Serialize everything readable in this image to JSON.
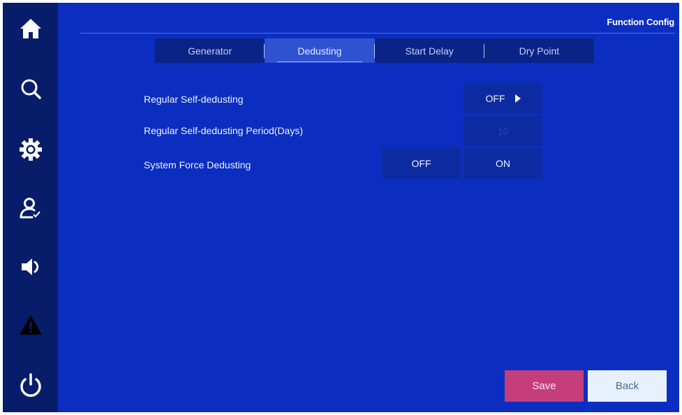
{
  "header": {
    "title": "Function Config"
  },
  "sidebar": {
    "items": [
      {
        "icon": "home-icon"
      },
      {
        "icon": "search-icon"
      },
      {
        "icon": "gear-icon"
      },
      {
        "icon": "user-check-icon"
      },
      {
        "icon": "speaker-icon"
      },
      {
        "icon": "warning-icon"
      },
      {
        "icon": "power-icon"
      }
    ]
  },
  "tabs": [
    {
      "label": "Generator",
      "active": false
    },
    {
      "label": "Dedusting",
      "active": true
    },
    {
      "label": "Start Delay",
      "active": false
    },
    {
      "label": "Dry Point",
      "active": false
    }
  ],
  "settings": {
    "regular_self_dedusting": {
      "label": "Regular Self-dedusting",
      "value": "OFF"
    },
    "regular_self_dedusting_period": {
      "label": "Regular Self-dedusting Period(Days)",
      "value": "10"
    },
    "system_force_dedusting": {
      "label": "System Force Dedusting",
      "off_label": "OFF",
      "on_label": "ON"
    }
  },
  "footer": {
    "save_label": "Save",
    "back_label": "Back"
  },
  "colors": {
    "background": "#0c2ec0",
    "sidebar": "#071d6a",
    "save": "#c53d7a",
    "back": "#e6f1fc"
  }
}
